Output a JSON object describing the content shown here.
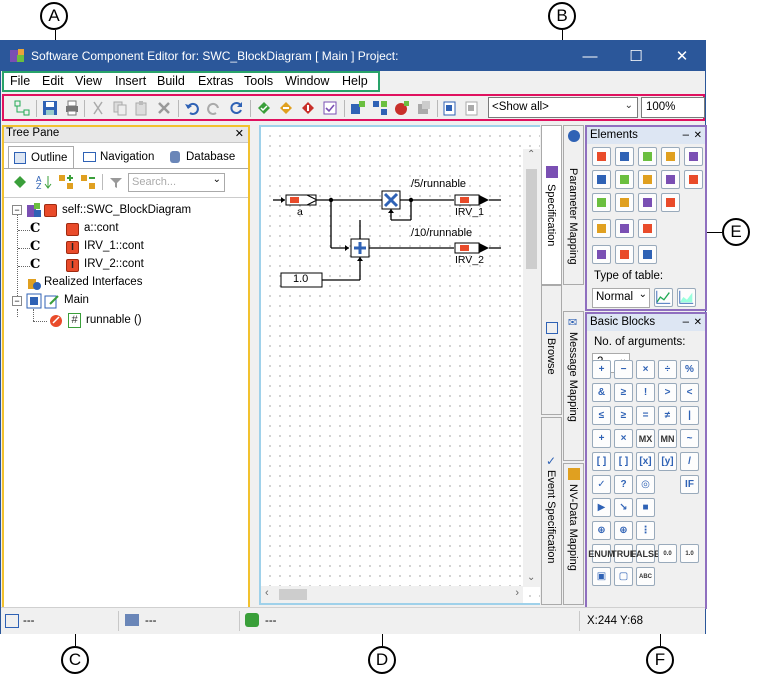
{
  "callouts": {
    "a": "A",
    "b": "B",
    "c": "C",
    "d": "D",
    "e": "E",
    "f": "F"
  },
  "window": {
    "title": "Software Component Editor for: SWC_BlockDiagram [ Main ] Project:",
    "minimize": "—",
    "maximize": "☐",
    "close": "✕"
  },
  "menu": [
    "File",
    "Edit",
    "View",
    "Insert",
    "Build",
    "Extras",
    "Tools",
    "Window",
    "Help"
  ],
  "toolbar": {
    "filter_value": "<Show all>",
    "zoom_value": "100%"
  },
  "tree_pane": {
    "header": "Tree Pane",
    "tabs": [
      "Outline",
      "Navigation",
      "Database"
    ],
    "search_placeholder": "Search...",
    "items": [
      "self::SWC_BlockDiagram",
      "a::cont",
      "IRV_1::cont",
      "IRV_2::cont",
      "Realized Interfaces",
      "Main",
      "runnable ()"
    ]
  },
  "diagram": {
    "input_a": "a",
    "label_5": "/5/runnable",
    "label_10": "/10/runnable",
    "irv1": "IRV_1",
    "irv2": "IRV_2",
    "constant": "1.0"
  },
  "vtabs": [
    "Parameter Mapping",
    "Specification",
    "Browse",
    "Message Mapping",
    "Event Specification",
    "NV-Data Mapping"
  ],
  "elements_panel": {
    "header": "Elements",
    "type_label": "Type of table:",
    "type_value": "Normal"
  },
  "blocks_panel": {
    "header": "Basic Blocks",
    "args_label": "No. of arguments:",
    "args_value": "2",
    "btn_mx": "MX",
    "btn_mn": "MN",
    "btn_enum": "ENUM",
    "btn_true": "TRUE",
    "btn_false": "FALSE",
    "btn_00": "0.0",
    "btn_10": "1.0",
    "btn_abc": "ABC"
  },
  "status": {
    "s1": "---",
    "s2": "---",
    "s3": "---",
    "coords": "X:244 Y:68"
  },
  "colors": {
    "titlebar": "#2b579a",
    "menu_outline": "#29a36a",
    "toolbar_outline": "#e0115f",
    "tree_outline": "#f2c12e",
    "diagram_outline": "#9fd1ea",
    "panels_outline": "#8f6fbf"
  }
}
